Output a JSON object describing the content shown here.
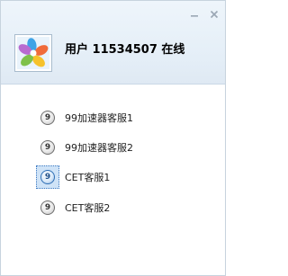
{
  "window": {
    "controls": {
      "minimize_icon": "minimize-icon",
      "close_icon": "close-icon"
    }
  },
  "user": {
    "title": "用户 11534507 在线",
    "avatar_icon": "colorful-petals-avatar"
  },
  "contacts": [
    {
      "number": "9",
      "label": "99加速器客服1",
      "selected": false
    },
    {
      "number": "9",
      "label": "99加速器客服2",
      "selected": false
    },
    {
      "number": "9",
      "label": "CET客服1",
      "selected": true
    },
    {
      "number": "9",
      "label": "CET客服2",
      "selected": false
    }
  ],
  "colors": {
    "header_bg": "#e4eef7",
    "border": "#c7d3de",
    "selection_bg": "#cfe3f7",
    "selection_border": "#3d79c2"
  }
}
